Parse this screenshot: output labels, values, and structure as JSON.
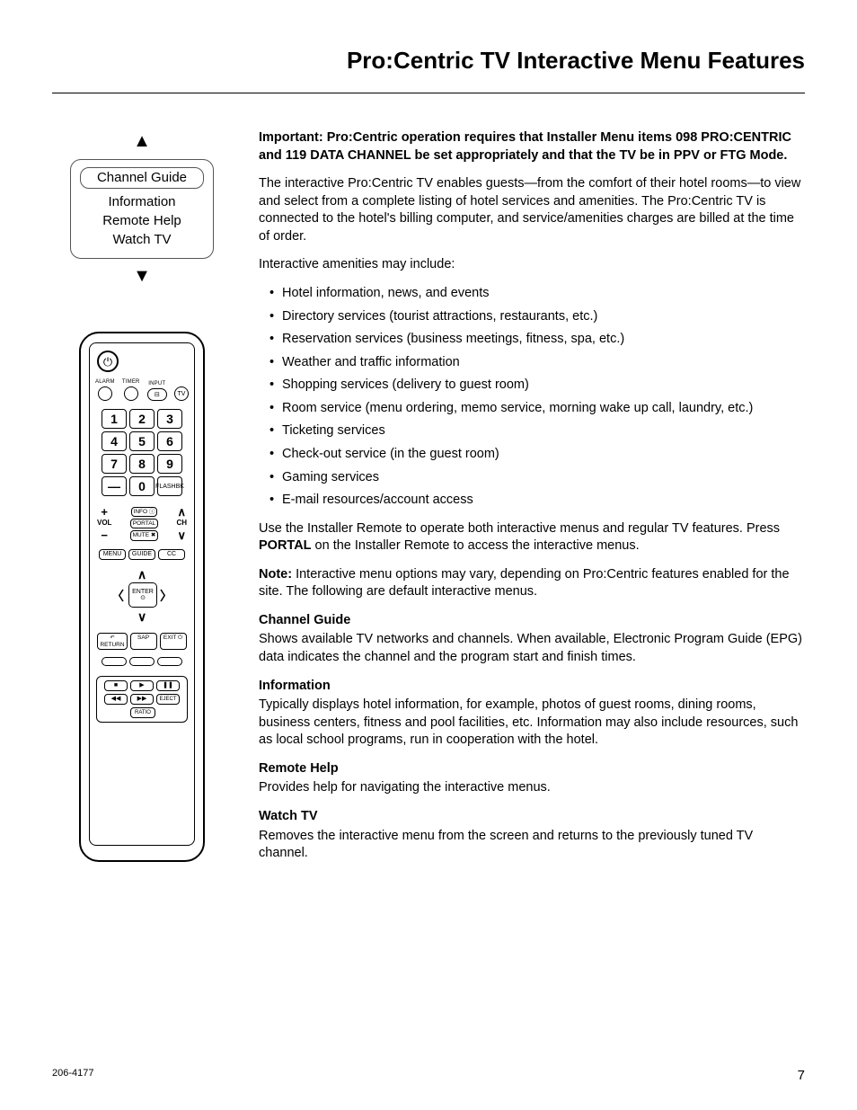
{
  "title": "Pro:Centric TV Interactive Menu Features",
  "menu": {
    "items": [
      "Channel Guide",
      "Information",
      "Remote Help",
      "Watch TV"
    ]
  },
  "remote": {
    "labels": {
      "alarm": "ALARM",
      "timer": "TIMER",
      "input": "INPUT",
      "tv": "TV",
      "flashbk": "FLASHBK",
      "vol": "VOL",
      "ch": "CH",
      "info": "INFO ⓘ",
      "portal": "PORTAL",
      "mute": "MUTE ✖",
      "menu": "MENU",
      "guide": "GUIDE",
      "cc": "CC",
      "enter": "ENTER",
      "enter_sym": "⊙",
      "return": "RETURN",
      "sap": "SAP",
      "exit": "EXIT ⏻",
      "eject": "EJECT",
      "ratio": "RATIO",
      "return_sym": "↶"
    },
    "numbers": [
      "1",
      "2",
      "3",
      "4",
      "5",
      "6",
      "7",
      "8",
      "9",
      "—",
      "0"
    ],
    "media": {
      "stop": "■",
      "play": "▶",
      "pause": "❚❚",
      "rew": "◀◀",
      "ff": "▶▶"
    }
  },
  "body": {
    "important": "Important: Pro:Centric operation requires that Installer Menu items 098 PRO:CENTRIC and 119 DATA CHANNEL be set appropriately and that the TV be in PPV or FTG Mode.",
    "p1": "The interactive Pro:Centric TV enables guests—from the comfort of their hotel rooms—to view and select from a complete listing of hotel services and amenities. The Pro:Centric TV is connected to the hotel's billing computer, and service/amenities charges are billed at the time of order.",
    "p2": "Interactive amenities may include:",
    "bullets": [
      "Hotel information, news, and events",
      "Directory services (tourist attractions, restaurants, etc.)",
      "Reservation services (business meetings, fitness, spa, etc.)",
      "Weather and traffic information",
      "Shopping services (delivery to guest room)",
      "Room service (menu ordering, memo service, morning wake up call, laundry, etc.)",
      "Ticketing services",
      "Check-out service (in the guest room)",
      "Gaming services",
      "E-mail resources/account access"
    ],
    "p3a": "Use the Installer Remote to operate both interactive menus and regular TV features. Press ",
    "p3b": "PORTAL",
    "p3c": " on the Installer Remote to access the interactive menus.",
    "note_label": "Note:",
    "note": " Interactive menu options may vary, depending on Pro:Centric features enabled for the site. The following are default interactive menus.",
    "sections": [
      {
        "h": "Channel Guide",
        "t": "Shows available TV networks and channels. When available, Electronic Program Guide (EPG) data indicates the channel and the program start and finish times."
      },
      {
        "h": "Information",
        "t": "Typically displays hotel information, for example, photos of guest rooms, dining rooms, business centers, fitness and pool facilities, etc. Information may also include resources, such as local school programs, run in cooperation with the hotel."
      },
      {
        "h": "Remote Help",
        "t": "Provides help for navigating the interactive menus."
      },
      {
        "h": "Watch TV",
        "t": "Removes the interactive menu from the screen and returns to the previously tuned TV channel."
      }
    ]
  },
  "footer": {
    "doc": "206-4177",
    "page": "7"
  }
}
